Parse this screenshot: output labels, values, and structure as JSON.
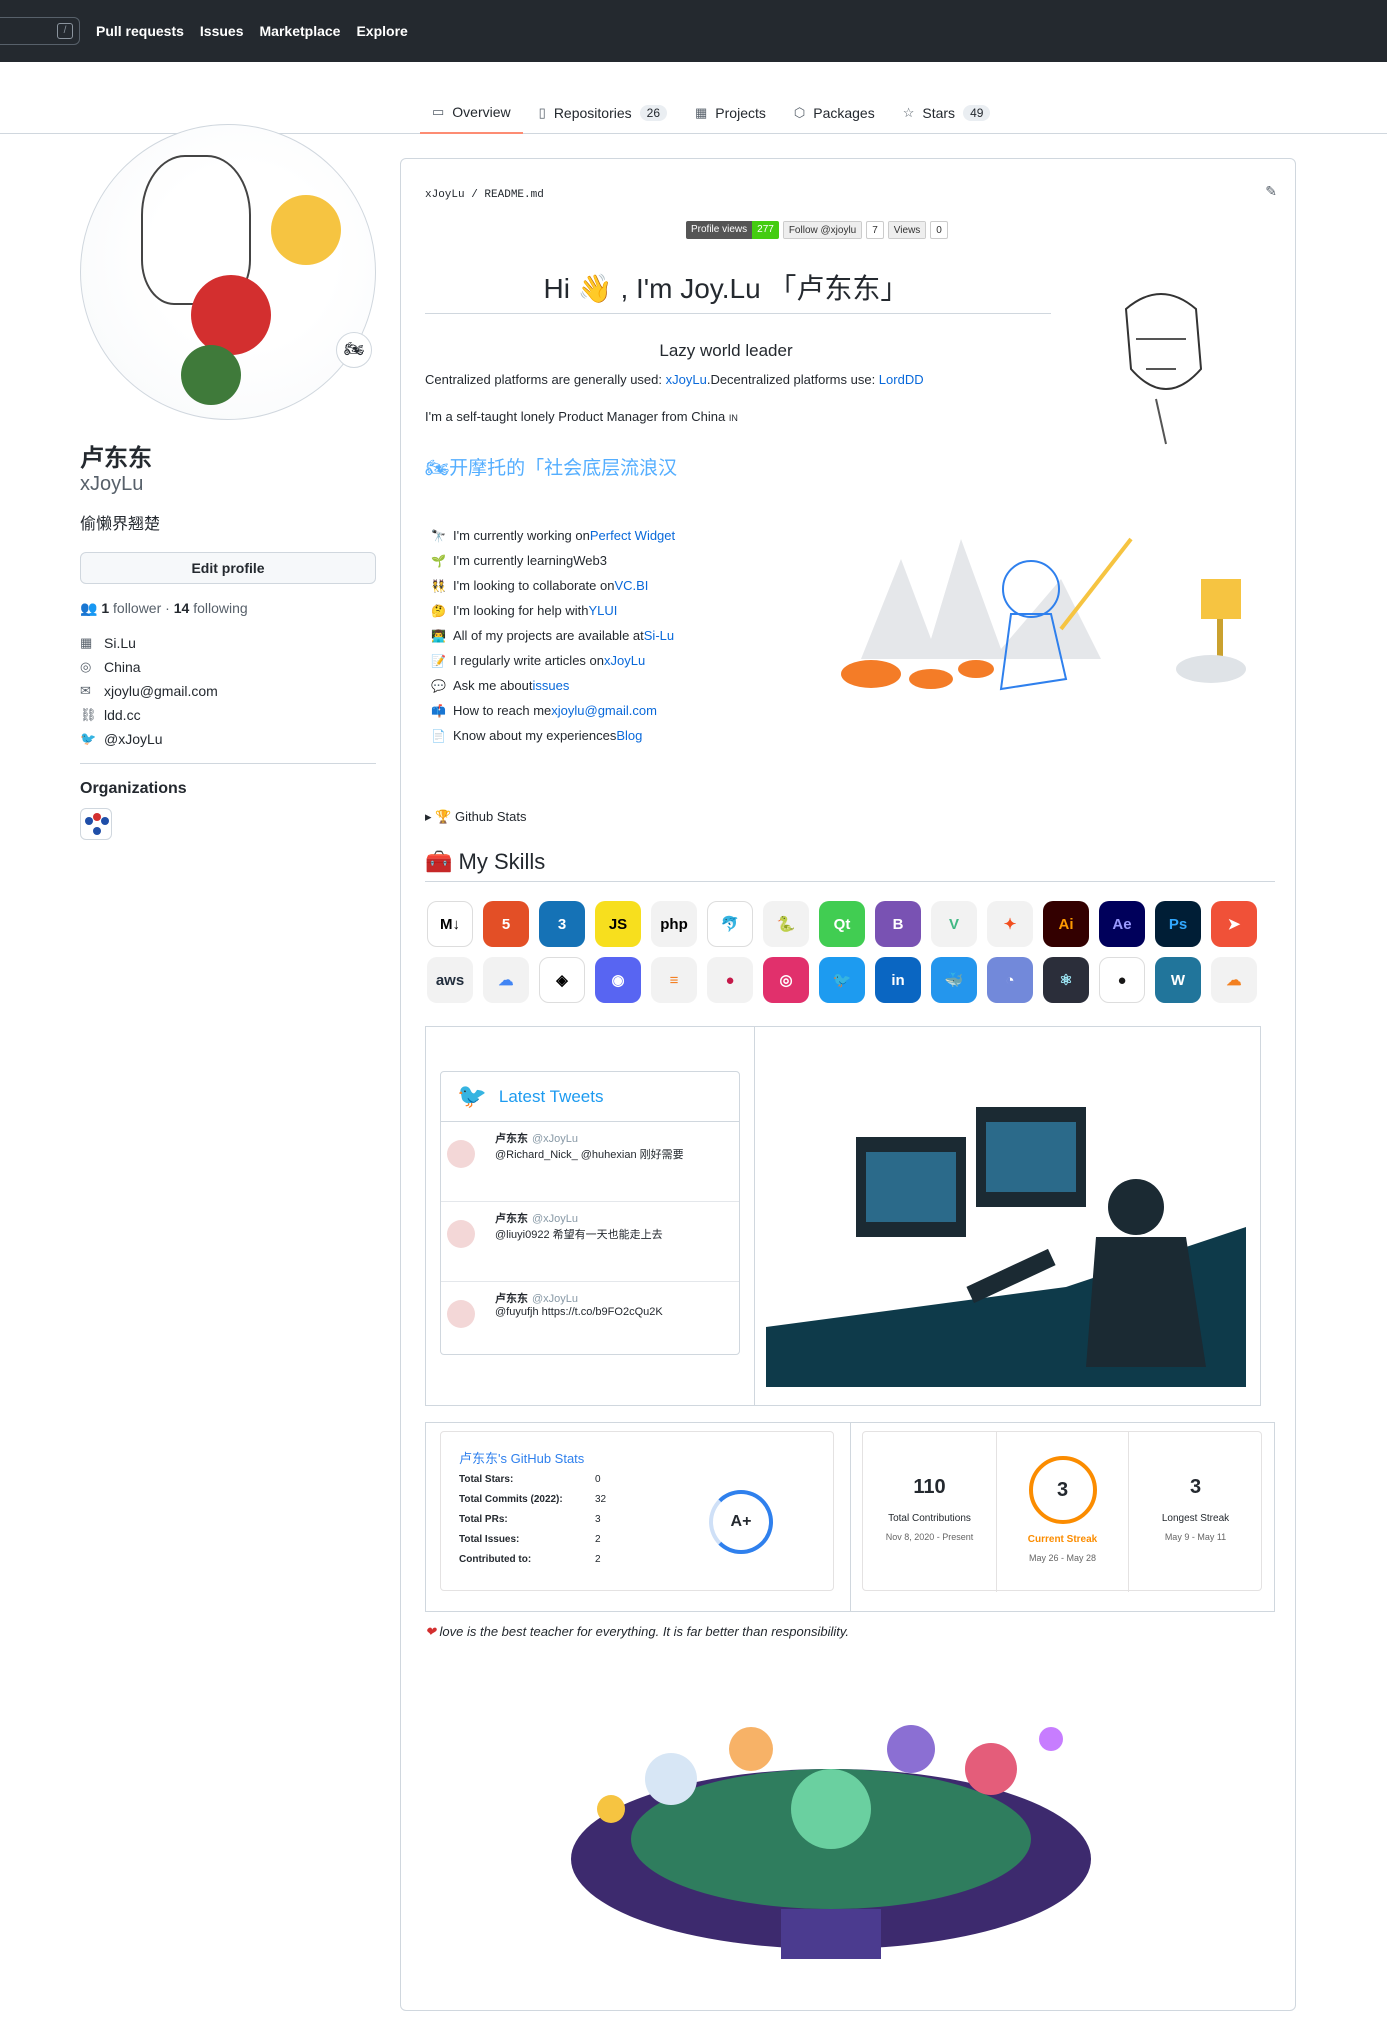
{
  "header": {
    "nav": [
      "Pull requests",
      "Issues",
      "Marketplace",
      "Explore"
    ],
    "search_hint": "/"
  },
  "tabs": [
    {
      "label": "Overview",
      "icon": "book-icon"
    },
    {
      "label": "Repositories",
      "count": "26",
      "icon": "repo-icon"
    },
    {
      "label": "Projects",
      "icon": "table-icon"
    },
    {
      "label": "Packages",
      "icon": "package-icon"
    },
    {
      "label": "Stars",
      "count": "49",
      "icon": "star-icon"
    }
  ],
  "profile": {
    "name": "卢东东",
    "login": "xJoyLu",
    "bio": "偷懒界翘楚",
    "edit_label": "Edit profile",
    "followers": "1",
    "followers_label": "follower",
    "following": "14",
    "following_label": "following",
    "sep": "·",
    "company": "Si.Lu",
    "location": "China",
    "email": "xjoylu@gmail.com",
    "website": "ldd.cc",
    "twitter": "@xJoyLu",
    "orgs_title": "Organizations"
  },
  "readme": {
    "path": "xJoyLu / README.md",
    "badges": {
      "views_label": "Profile views",
      "views": "277",
      "follow_label": "Follow @xjoylu",
      "follow_count": "7",
      "yt_label": "Views",
      "yt_count": "0"
    },
    "title_pre": "Hi",
    "title_post": ", I'm Joy.Lu 「卢东东」",
    "subtitle": "Lazy world leader",
    "platforms_pre": "Centralized platforms are generally used: ",
    "platforms_link1": "xJoyLu",
    "platforms_mid": ".Decentralized platforms use: ",
    "platforms_link2": "LordDD",
    "selftaught": "I'm a self-taught lonely Product Manager from China",
    "selftaught_flag": "IN",
    "moto": "开摩托的「社会底层流浪汉",
    "items": [
      {
        "emoji": "🔭",
        "pre": "I'm currently working on ",
        "link": "Perfect Widget",
        "post": ""
      },
      {
        "emoji": "🌱",
        "pre": "I'm currently learning ",
        "link": "",
        "post": "Web3"
      },
      {
        "emoji": "👯",
        "pre": "I'm looking to collaborate on ",
        "link": "VC.BI",
        "post": ""
      },
      {
        "emoji": "🤔",
        "pre": "I'm looking for help with ",
        "link": "YLUI",
        "post": ""
      },
      {
        "emoji": "👨‍💻",
        "pre": "All of my projects are available at ",
        "link": "Si-Lu",
        "post": ""
      },
      {
        "emoji": "📝",
        "pre": "I regularly write articles on ",
        "link": "xJoyLu",
        "post": ""
      },
      {
        "emoji": "💬",
        "pre": "Ask me about ",
        "link": "issues",
        "post": ""
      },
      {
        "emoji": "📫",
        "pre": "How to reach me ",
        "link": "xjoylu@gmail.com",
        "post": ""
      },
      {
        "emoji": "📄",
        "pre": "Know about my experiences ",
        "link": "Blog",
        "post": ""
      }
    ],
    "github_stats_toggle": "Github Stats",
    "skills_title": "My Skills",
    "skills": [
      {
        "label": "M↓",
        "bg": "#ffffff",
        "fg": "#000000"
      },
      {
        "label": "5",
        "bg": "#e34f26",
        "fg": "#ffffff"
      },
      {
        "label": "3",
        "bg": "#1572b6",
        "fg": "#ffffff"
      },
      {
        "label": "JS",
        "bg": "#f7df1e",
        "fg": "#000000"
      },
      {
        "label": "php",
        "bg": "#f2f2f2",
        "fg": "#000000"
      },
      {
        "label": "🐬",
        "bg": "#ffffff",
        "fg": "#4479a1"
      },
      {
        "label": "🐍",
        "bg": "#f2f2f2",
        "fg": "#3776ab"
      },
      {
        "label": "Qt",
        "bg": "#41cd52",
        "fg": "#ffffff"
      },
      {
        "label": "B",
        "bg": "#7952b3",
        "fg": "#ffffff"
      },
      {
        "label": "V",
        "bg": "#f2f2f2",
        "fg": "#41b883"
      },
      {
        "label": "✦",
        "bg": "#f2f2f2",
        "fg": "#f24e1e"
      },
      {
        "label": "Ai",
        "bg": "#330000",
        "fg": "#ff9a00"
      },
      {
        "label": "Ae",
        "bg": "#00005b",
        "fg": "#9999ff"
      },
      {
        "label": "Ps",
        "bg": "#001e36",
        "fg": "#31a8ff"
      },
      {
        "label": "➤",
        "bg": "#f05138",
        "fg": "#ffffff"
      },
      {
        "label": "aws",
        "bg": "#f2f2f2",
        "fg": "#232f3e"
      },
      {
        "label": "☁",
        "bg": "#f2f2f2",
        "fg": "#4285f4"
      },
      {
        "label": "◈",
        "bg": "#ffffff",
        "fg": "#000000"
      },
      {
        "label": "◉",
        "bg": "#5865f2",
        "fg": "#ffffff"
      },
      {
        "label": "≡",
        "bg": "#f2f2f2",
        "fg": "#f48024"
      },
      {
        "label": "●",
        "bg": "#f2f2f2",
        "fg": "#c51a4a"
      },
      {
        "label": "◎",
        "bg": "#e1306c",
        "fg": "#ffffff"
      },
      {
        "label": "🐦",
        "bg": "#1d9bf0",
        "fg": "#ffffff"
      },
      {
        "label": "in",
        "bg": "#0a66c2",
        "fg": "#ffffff"
      },
      {
        "label": "🐳",
        "bg": "#2496ed",
        "fg": "#ffffff"
      },
      {
        "label": "◔",
        "bg": "#7289da",
        "fg": "#ffffff"
      },
      {
        "label": "⚛",
        "bg": "#2b2e3a",
        "fg": "#9feaf9"
      },
      {
        "label": "●",
        "bg": "#ffffff",
        "fg": "#181717"
      },
      {
        "label": "W",
        "bg": "#21759b",
        "fg": "#ffffff"
      },
      {
        "label": "☁",
        "bg": "#f2f2f2",
        "fg": "#f38020"
      }
    ],
    "tweets_title": "Latest Tweets",
    "tweets": [
      {
        "name": "卢东东",
        "handle": "@xJoyLu",
        "text": "@Richard_Nick_ @huhexian 刚好需要"
      },
      {
        "name": "卢东东",
        "handle": "@xJoyLu",
        "text": "@liuyi0922 希望有一天也能走上去"
      },
      {
        "name": "卢东东",
        "handle": "@xJoyLu",
        "text": "@fuyufjh https://t.co/b9FO2cQu2K"
      }
    ],
    "stats": {
      "title": "卢东东's GitHub Stats",
      "rows": [
        {
          "label": "Total Stars:",
          "value": "0"
        },
        {
          "label": "Total Commits (2022):",
          "value": "32"
        },
        {
          "label": "Total PRs:",
          "value": "3"
        },
        {
          "label": "Total Issues:",
          "value": "2"
        },
        {
          "label": "Contributed to:",
          "value": "2"
        }
      ],
      "grade": "A+"
    },
    "streak": {
      "total": "110",
      "total_label": "Total Contributions",
      "total_range": "Nov 8, 2020 - Present",
      "current": "3",
      "current_label": "Current Streak",
      "current_range": "May 26 - May 28",
      "longest": "3",
      "longest_label": "Longest Streak",
      "longest_range": "May 9 - May 11"
    },
    "love": "love is the best teacher for everything. It is far better than responsibility."
  },
  "colors": {
    "accent": "#0969da",
    "tab_underline": "#fd8c73",
    "topbar": "#24292f"
  }
}
